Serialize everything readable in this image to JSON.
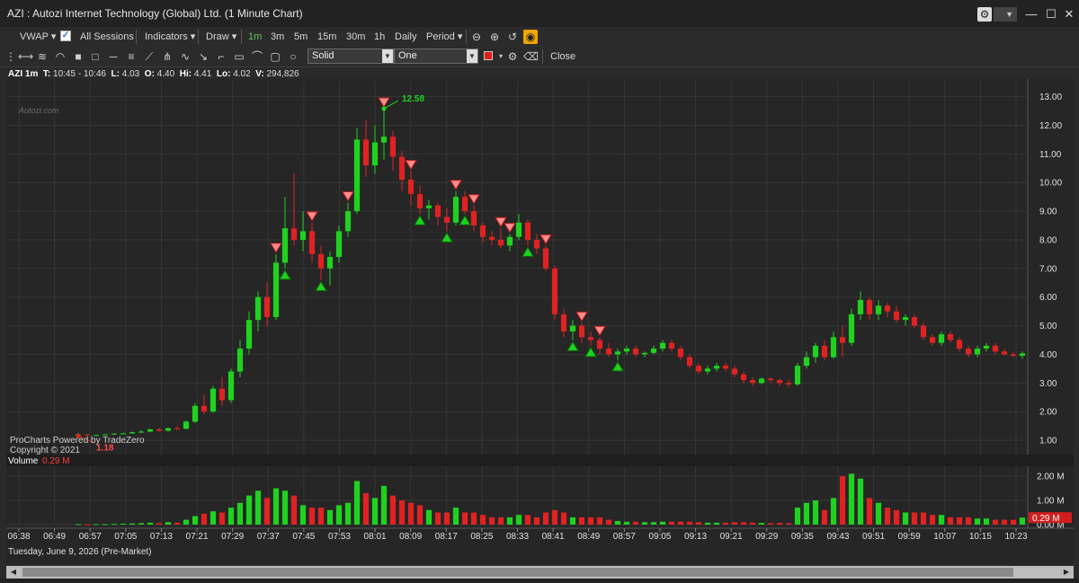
{
  "window": {
    "title": "AZI : Autozi Internet Technology (Global) Ltd. (1 Minute Chart)",
    "minimize": "—",
    "maximize": "☐",
    "close": "✕"
  },
  "toolbar1": {
    "vwap": "VWAP",
    "sessions": "All Sessions",
    "indicators": "Indicators",
    "draw": "Draw",
    "timeframes": [
      "1m",
      "3m",
      "5m",
      "15m",
      "30m",
      "1h",
      "Daily"
    ],
    "period": "Period"
  },
  "toolbar2": {
    "line_style": "Solid",
    "line_width": "One",
    "line_color": "#e11b1b",
    "close": "Close"
  },
  "ohlc": {
    "symbol": "AZI 1m",
    "t_label": "T:",
    "t_value": "10:45 - 10:46",
    "l_label": "L:",
    "l_value": "4.03",
    "o_label": "O:",
    "o_value": "4.40",
    "hi_label": "Hi:",
    "hi_value": "4.41",
    "lo_label": "Lo:",
    "lo_value": "4.02",
    "v_label": "V:",
    "v_value": "294,826"
  },
  "watermark": "Autozi.com",
  "branding": [
    "ProCharts Powered by TradeZero",
    "Copyright © 2021"
  ],
  "volume_panel": {
    "label": "Volume",
    "value": "0.29 M"
  },
  "date_label": "Tuesday, June 9, 2026 (Pre-Market)",
  "colors": {
    "up": "#1fd21f",
    "down": "#e02222",
    "bg": "#262626",
    "grid": "#353535",
    "accent": "#f0a500"
  },
  "chart_data": {
    "type": "candlestick",
    "price_axis": {
      "min": 0.5,
      "max": 13.3,
      "ticks": [
        "1.00",
        "2.00",
        "3.00",
        "4.00",
        "5.00",
        "6.00",
        "7.00",
        "8.00",
        "9.00",
        "10.00",
        "11.00",
        "12.00",
        "13.00"
      ]
    },
    "volume_axis": {
      "min": 0,
      "max": 2.3,
      "ticks": [
        "0.00 M",
        "1.00 M",
        "2.00 M"
      ]
    },
    "time_ticks": [
      "06:38",
      "06:49",
      "06:57",
      "07:05",
      "07:13",
      "07:21",
      "07:29",
      "07:37",
      "07:45",
      "07:53",
      "08:01",
      "08:09",
      "08:17",
      "08:25",
      "08:33",
      "08:41",
      "08:49",
      "08:57",
      "09:05",
      "09:13",
      "09:21",
      "09:29",
      "09:35",
      "09:43",
      "09:51",
      "09:59",
      "10:07",
      "10:15",
      "10:23"
    ],
    "annotations": {
      "high_label": "12.58",
      "low_label": "1.18",
      "last_volume": "0.29 M"
    },
    "candles": [
      [
        1.2,
        1.25,
        1.15,
        1.2,
        0.02
      ],
      [
        1.2,
        1.22,
        1.18,
        1.19,
        0.01
      ],
      [
        1.18,
        1.2,
        1.17,
        1.18,
        0.02
      ],
      [
        1.2,
        1.22,
        1.18,
        1.2,
        0.02
      ],
      [
        1.2,
        1.24,
        1.19,
        1.23,
        0.03
      ],
      [
        1.23,
        1.26,
        1.2,
        1.24,
        0.04
      ],
      [
        1.24,
        1.3,
        1.22,
        1.28,
        0.05
      ],
      [
        1.28,
        1.35,
        1.25,
        1.3,
        0.06
      ],
      [
        1.3,
        1.4,
        1.28,
        1.38,
        0.08
      ],
      [
        1.38,
        1.42,
        1.3,
        1.33,
        0.06
      ],
      [
        1.33,
        1.45,
        1.3,
        1.42,
        0.1
      ],
      [
        1.42,
        1.5,
        1.35,
        1.4,
        0.08
      ],
      [
        1.4,
        1.7,
        1.38,
        1.65,
        0.2
      ],
      [
        1.65,
        2.3,
        1.6,
        2.2,
        0.35
      ],
      [
        2.2,
        2.6,
        1.9,
        2.0,
        0.45
      ],
      [
        2.0,
        2.9,
        1.95,
        2.8,
        0.55
      ],
      [
        2.8,
        3.2,
        2.2,
        2.4,
        0.5
      ],
      [
        2.4,
        3.5,
        2.3,
        3.4,
        0.7
      ],
      [
        3.4,
        4.5,
        3.2,
        4.2,
        0.9
      ],
      [
        4.2,
        5.5,
        4.0,
        5.2,
        1.2
      ],
      [
        5.2,
        6.2,
        4.8,
        6.0,
        1.4
      ],
      [
        6.0,
        6.5,
        5.0,
        5.3,
        1.1
      ],
      [
        5.3,
        7.5,
        5.2,
        7.2,
        1.5
      ],
      [
        7.2,
        9.5,
        7.0,
        8.4,
        1.4
      ],
      [
        8.4,
        10.3,
        7.8,
        8.0,
        1.2
      ],
      [
        8.0,
        9.0,
        7.6,
        8.3,
        0.8
      ],
      [
        8.3,
        8.6,
        7.2,
        7.5,
        0.7
      ],
      [
        7.5,
        7.8,
        6.6,
        7.0,
        0.7
      ],
      [
        7.0,
        7.6,
        6.4,
        7.4,
        0.6
      ],
      [
        7.4,
        8.5,
        7.2,
        8.3,
        0.8
      ],
      [
        8.3,
        9.3,
        8.1,
        9.0,
        0.9
      ],
      [
        9.0,
        11.9,
        8.9,
        11.5,
        1.8
      ],
      [
        11.5,
        12.2,
        10.2,
        10.6,
        1.3
      ],
      [
        10.6,
        12.0,
        10.3,
        11.4,
        1.1
      ],
      [
        11.4,
        12.58,
        10.8,
        11.6,
        1.6
      ],
      [
        11.6,
        11.8,
        10.4,
        10.9,
        1.2
      ],
      [
        10.9,
        11.1,
        9.7,
        10.1,
        1.0
      ],
      [
        10.1,
        10.4,
        9.2,
        9.6,
        0.9
      ],
      [
        9.6,
        9.9,
        8.9,
        9.1,
        0.8
      ],
      [
        9.1,
        9.4,
        8.7,
        9.2,
        0.6
      ],
      [
        9.2,
        9.3,
        8.5,
        8.8,
        0.5
      ],
      [
        8.8,
        9.1,
        8.3,
        8.6,
        0.5
      ],
      [
        8.6,
        9.7,
        8.5,
        9.5,
        0.7
      ],
      [
        9.5,
        9.7,
        8.9,
        9.0,
        0.5
      ],
      [
        9.0,
        9.2,
        8.3,
        8.5,
        0.5
      ],
      [
        8.5,
        8.6,
        7.9,
        8.1,
        0.4
      ],
      [
        8.1,
        8.3,
        7.8,
        8.0,
        0.3
      ],
      [
        8.0,
        8.4,
        7.7,
        7.8,
        0.3
      ],
      [
        7.8,
        8.2,
        7.6,
        8.1,
        0.3
      ],
      [
        8.1,
        8.9,
        8.0,
        8.6,
        0.4
      ],
      [
        8.6,
        8.7,
        7.8,
        8.0,
        0.4
      ],
      [
        8.0,
        8.2,
        7.5,
        7.7,
        0.3
      ],
      [
        7.7,
        7.8,
        6.9,
        7.0,
        0.5
      ],
      [
        7.0,
        7.1,
        5.2,
        5.4,
        0.6
      ],
      [
        5.4,
        5.6,
        4.6,
        4.8,
        0.5
      ],
      [
        4.8,
        5.2,
        4.5,
        5.0,
        0.3
      ],
      [
        5.0,
        5.1,
        4.4,
        4.6,
        0.3
      ],
      [
        4.6,
        4.8,
        4.3,
        4.5,
        0.3
      ],
      [
        4.5,
        4.6,
        4.0,
        4.2,
        0.3
      ],
      [
        4.2,
        4.4,
        3.9,
        4.0,
        0.2
      ],
      [
        4.0,
        4.2,
        3.8,
        4.1,
        0.15
      ],
      [
        4.1,
        4.3,
        4.0,
        4.2,
        0.12
      ],
      [
        4.2,
        4.3,
        3.9,
        4.0,
        0.12
      ],
      [
        4.0,
        4.1,
        3.9,
        4.05,
        0.1
      ],
      [
        4.05,
        4.3,
        4.0,
        4.2,
        0.1
      ],
      [
        4.2,
        4.5,
        4.1,
        4.4,
        0.12
      ],
      [
        4.4,
        4.5,
        4.1,
        4.2,
        0.12
      ],
      [
        4.2,
        4.3,
        3.8,
        3.9,
        0.12
      ],
      [
        3.9,
        4.0,
        3.5,
        3.6,
        0.12
      ],
      [
        3.6,
        3.7,
        3.3,
        3.4,
        0.1
      ],
      [
        3.4,
        3.6,
        3.3,
        3.5,
        0.08
      ],
      [
        3.5,
        3.7,
        3.4,
        3.6,
        0.08
      ],
      [
        3.6,
        3.7,
        3.4,
        3.5,
        0.08
      ],
      [
        3.5,
        3.6,
        3.2,
        3.3,
        0.1
      ],
      [
        3.3,
        3.4,
        3.0,
        3.1,
        0.1
      ],
      [
        3.1,
        3.2,
        2.9,
        3.0,
        0.08
      ],
      [
        3.0,
        3.2,
        2.95,
        3.15,
        0.07
      ],
      [
        3.15,
        3.2,
        3.0,
        3.1,
        0.06
      ],
      [
        3.1,
        3.15,
        2.9,
        3.0,
        0.07
      ],
      [
        3.0,
        3.1,
        2.85,
        2.95,
        0.06
      ],
      [
        2.95,
        3.7,
        2.9,
        3.6,
        0.7
      ],
      [
        3.6,
        4.1,
        3.5,
        3.9,
        0.9
      ],
      [
        3.9,
        4.4,
        3.7,
        4.3,
        1.0
      ],
      [
        4.3,
        4.5,
        3.8,
        3.9,
        0.6
      ],
      [
        3.9,
        4.8,
        3.85,
        4.6,
        1.1
      ],
      [
        4.6,
        5.0,
        3.9,
        4.4,
        2.0
      ],
      [
        4.4,
        5.6,
        4.3,
        5.4,
        2.1
      ],
      [
        5.4,
        6.2,
        5.2,
        5.9,
        1.9
      ],
      [
        5.9,
        6.0,
        5.2,
        5.4,
        1.1
      ],
      [
        5.4,
        5.9,
        5.2,
        5.7,
        0.9
      ],
      [
        5.7,
        5.8,
        5.3,
        5.5,
        0.7
      ],
      [
        5.5,
        5.7,
        5.1,
        5.2,
        0.6
      ],
      [
        5.2,
        5.4,
        5.0,
        5.3,
        0.5
      ],
      [
        5.3,
        5.4,
        4.9,
        5.0,
        0.5
      ],
      [
        5.0,
        5.1,
        4.5,
        4.6,
        0.5
      ],
      [
        4.6,
        4.7,
        4.3,
        4.4,
        0.4
      ],
      [
        4.4,
        4.8,
        4.3,
        4.7,
        0.4
      ],
      [
        4.7,
        4.8,
        4.4,
        4.5,
        0.3
      ],
      [
        4.5,
        4.6,
        4.1,
        4.2,
        0.3
      ],
      [
        4.2,
        4.3,
        3.9,
        4.0,
        0.3
      ],
      [
        4.0,
        4.3,
        3.9,
        4.2,
        0.25
      ],
      [
        4.2,
        4.4,
        4.1,
        4.3,
        0.25
      ],
      [
        4.3,
        4.4,
        4.0,
        4.1,
        0.2
      ],
      [
        4.1,
        4.2,
        3.95,
        4.0,
        0.2
      ],
      [
        4.0,
        4.1,
        3.9,
        3.95,
        0.2
      ],
      [
        3.95,
        4.1,
        3.85,
        4.03,
        0.29
      ]
    ],
    "markers": [
      {
        "i": 30,
        "dir": "down"
      },
      {
        "i": 34,
        "dir": "down"
      },
      {
        "i": 37,
        "dir": "down"
      },
      {
        "i": 38,
        "dir": "up"
      },
      {
        "i": 41,
        "dir": "up"
      },
      {
        "i": 42,
        "dir": "down"
      },
      {
        "i": 44,
        "dir": "down"
      },
      {
        "i": 43,
        "dir": "up"
      },
      {
        "i": 47,
        "dir": "down"
      },
      {
        "i": 48,
        "dir": "down"
      },
      {
        "i": 50,
        "dir": "up"
      },
      {
        "i": 52,
        "dir": "down"
      },
      {
        "i": 55,
        "dir": "up"
      },
      {
        "i": 56,
        "dir": "down"
      },
      {
        "i": 57,
        "dir": "up"
      },
      {
        "i": 58,
        "dir": "down"
      },
      {
        "i": 60,
        "dir": "up"
      },
      {
        "i": 27,
        "dir": "up"
      },
      {
        "i": 26,
        "dir": "down"
      },
      {
        "i": 22,
        "dir": "down"
      },
      {
        "i": 23,
        "dir": "up"
      }
    ]
  }
}
